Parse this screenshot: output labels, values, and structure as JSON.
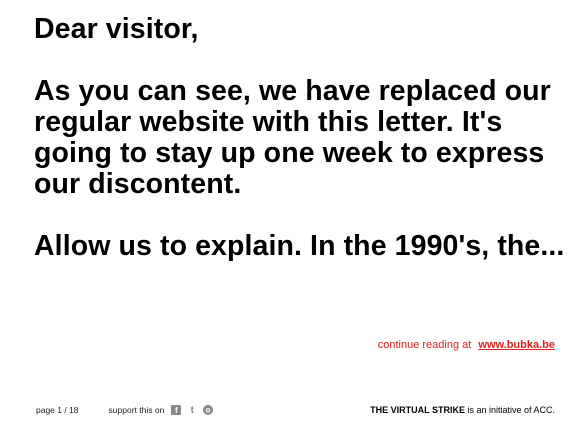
{
  "letter": {
    "salutation": "Dear visitor,",
    "paragraph1": "As you can see, we have replaced our regular website with this letter. It's going to stay up one week to express our discontent.",
    "paragraph2": "Allow us to explain. In the 1990's, the..."
  },
  "continue": {
    "text": "continue reading at",
    "link_label": "www.bubka.be",
    "color": "#e02020"
  },
  "footer": {
    "pager": "page 1 / 18",
    "support_label": "support this on",
    "social_icons": [
      "facebook-icon",
      "twitter-icon",
      "github-icon"
    ],
    "initiative_bold": "THE VIRTUAL STRIKE",
    "initiative_rest": " is an initiative of ACC."
  }
}
